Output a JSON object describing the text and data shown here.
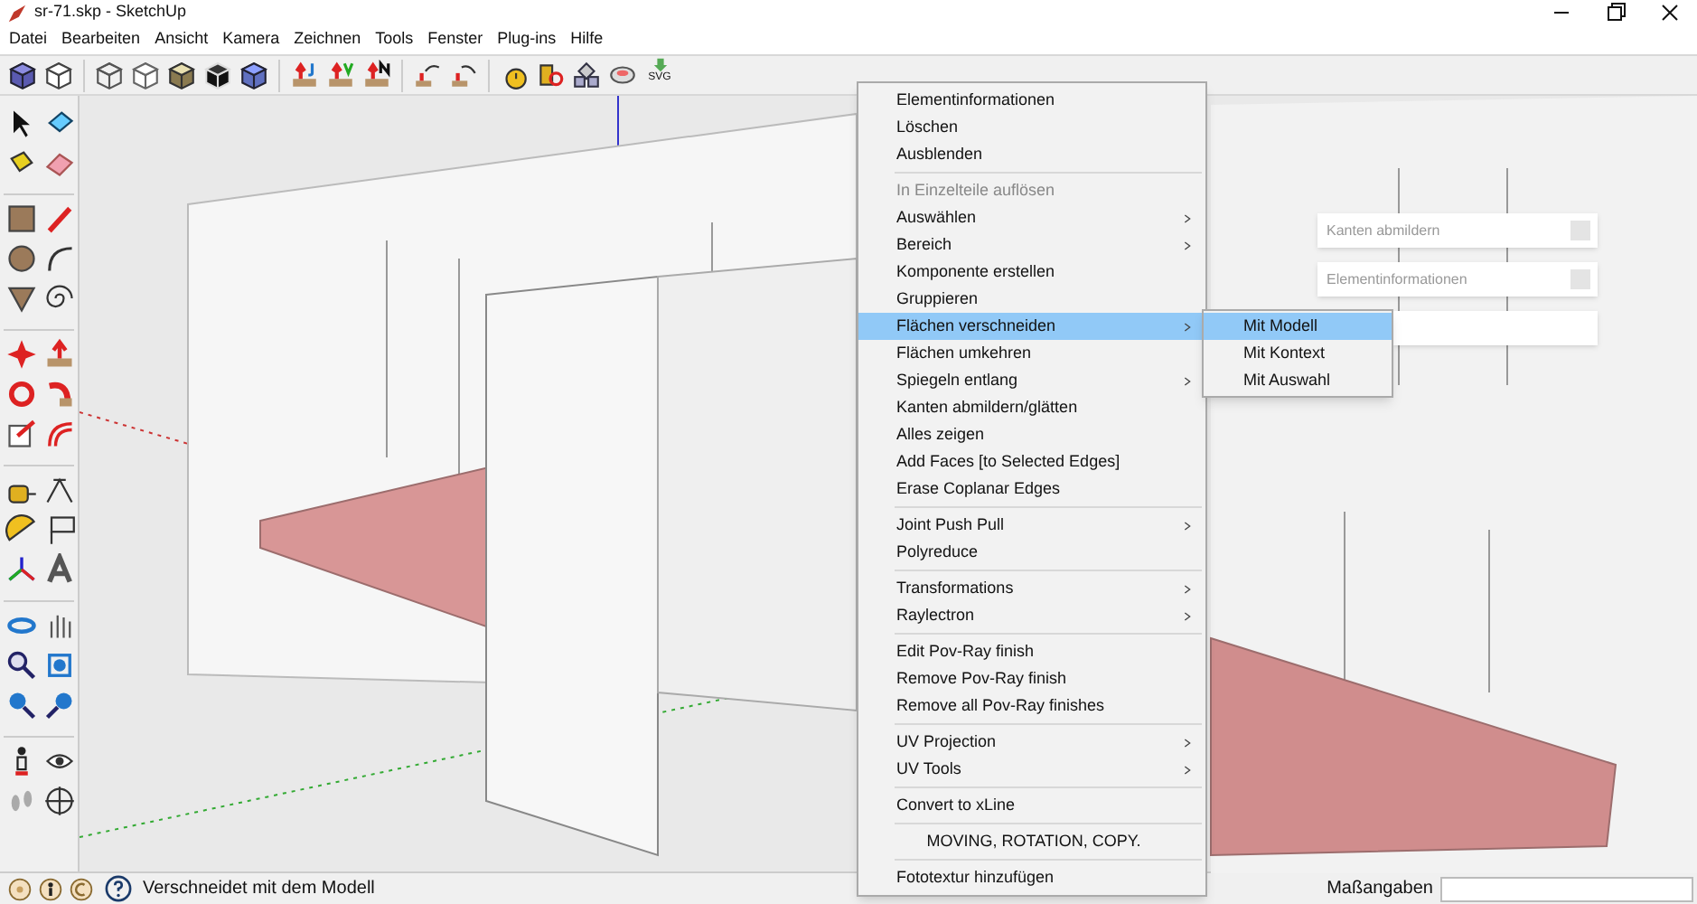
{
  "window": {
    "title": "sr-71.skp - SketchUp"
  },
  "menu_bar": [
    "Datei",
    "Bearbeiten",
    "Ansicht",
    "Kamera",
    "Zeichnen",
    "Tools",
    "Fenster",
    "Plug-ins",
    "Hilfe"
  ],
  "toolbar": {
    "svg_button": "SVG"
  },
  "tray_panels": [
    {
      "title": "Kanten abmildern"
    },
    {
      "title": "Elementinformationen"
    }
  ],
  "context_menu": [
    {
      "kind": "item",
      "label": "Elementinformationen",
      "disabled": false,
      "submenu": false,
      "selected": false
    },
    {
      "kind": "item",
      "label": "Löschen",
      "disabled": false,
      "submenu": false,
      "selected": false
    },
    {
      "kind": "item",
      "label": "Ausblenden",
      "disabled": false,
      "submenu": false,
      "selected": false
    },
    {
      "kind": "separator"
    },
    {
      "kind": "item",
      "label": "In Einzelteile auflösen",
      "disabled": true,
      "submenu": false,
      "selected": false
    },
    {
      "kind": "item",
      "label": "Auswählen",
      "disabled": false,
      "submenu": true,
      "selected": false
    },
    {
      "kind": "item",
      "label": "Bereich",
      "disabled": false,
      "submenu": true,
      "selected": false
    },
    {
      "kind": "item",
      "label": "Komponente erstellen",
      "disabled": false,
      "submenu": false,
      "selected": false
    },
    {
      "kind": "item",
      "label": "Gruppieren",
      "disabled": false,
      "submenu": false,
      "selected": false
    },
    {
      "kind": "item",
      "label": "Flächen verschneiden",
      "disabled": false,
      "submenu": true,
      "selected": true
    },
    {
      "kind": "item",
      "label": "Flächen umkehren",
      "disabled": false,
      "submenu": false,
      "selected": false
    },
    {
      "kind": "item",
      "label": "Spiegeln entlang",
      "disabled": false,
      "submenu": true,
      "selected": false
    },
    {
      "kind": "item",
      "label": "Kanten abmildern/glätten",
      "disabled": false,
      "submenu": false,
      "selected": false
    },
    {
      "kind": "item",
      "label": "Alles zeigen",
      "disabled": false,
      "submenu": false,
      "selected": false
    },
    {
      "kind": "item",
      "label": "Add Faces [to Selected Edges]",
      "disabled": false,
      "submenu": false,
      "selected": false
    },
    {
      "kind": "item",
      "label": "Erase Coplanar Edges",
      "disabled": false,
      "submenu": false,
      "selected": false
    },
    {
      "kind": "separator"
    },
    {
      "kind": "item",
      "label": "Joint Push Pull",
      "disabled": false,
      "submenu": true,
      "selected": false
    },
    {
      "kind": "item",
      "label": "Polyreduce",
      "disabled": false,
      "submenu": false,
      "selected": false
    },
    {
      "kind": "separator"
    },
    {
      "kind": "item",
      "label": "Transformations",
      "disabled": false,
      "submenu": true,
      "selected": false
    },
    {
      "kind": "item",
      "label": "Raylectron",
      "disabled": false,
      "submenu": true,
      "selected": false
    },
    {
      "kind": "separator"
    },
    {
      "kind": "item",
      "label": "Edit Pov-Ray finish",
      "disabled": false,
      "submenu": false,
      "selected": false
    },
    {
      "kind": "item",
      "label": "Remove Pov-Ray finish",
      "disabled": false,
      "submenu": false,
      "selected": false
    },
    {
      "kind": "item",
      "label": "Remove all Pov-Ray finishes",
      "disabled": false,
      "submenu": false,
      "selected": false
    },
    {
      "kind": "separator"
    },
    {
      "kind": "item",
      "label": "UV Projection",
      "disabled": false,
      "submenu": true,
      "selected": false
    },
    {
      "kind": "item",
      "label": "UV Tools",
      "disabled": false,
      "submenu": true,
      "selected": false
    },
    {
      "kind": "separator"
    },
    {
      "kind": "item",
      "label": "Convert to xLine",
      "disabled": false,
      "submenu": false,
      "selected": false
    },
    {
      "kind": "separator"
    },
    {
      "kind": "centered",
      "label": "MOVING, ROTATION, COPY.",
      "disabled": false,
      "submenu": false,
      "selected": false
    },
    {
      "kind": "separator"
    },
    {
      "kind": "item",
      "label": "Fototextur hinzufügen",
      "disabled": false,
      "submenu": false,
      "selected": false
    }
  ],
  "submenu": [
    {
      "label": "Mit Modell",
      "selected": true
    },
    {
      "label": "Mit Kontext",
      "selected": false
    },
    {
      "label": "Mit Auswahl",
      "selected": false
    }
  ],
  "status_bar": {
    "hint": "Verschneidet mit dem Modell",
    "measurements_label": "Maßangaben"
  }
}
